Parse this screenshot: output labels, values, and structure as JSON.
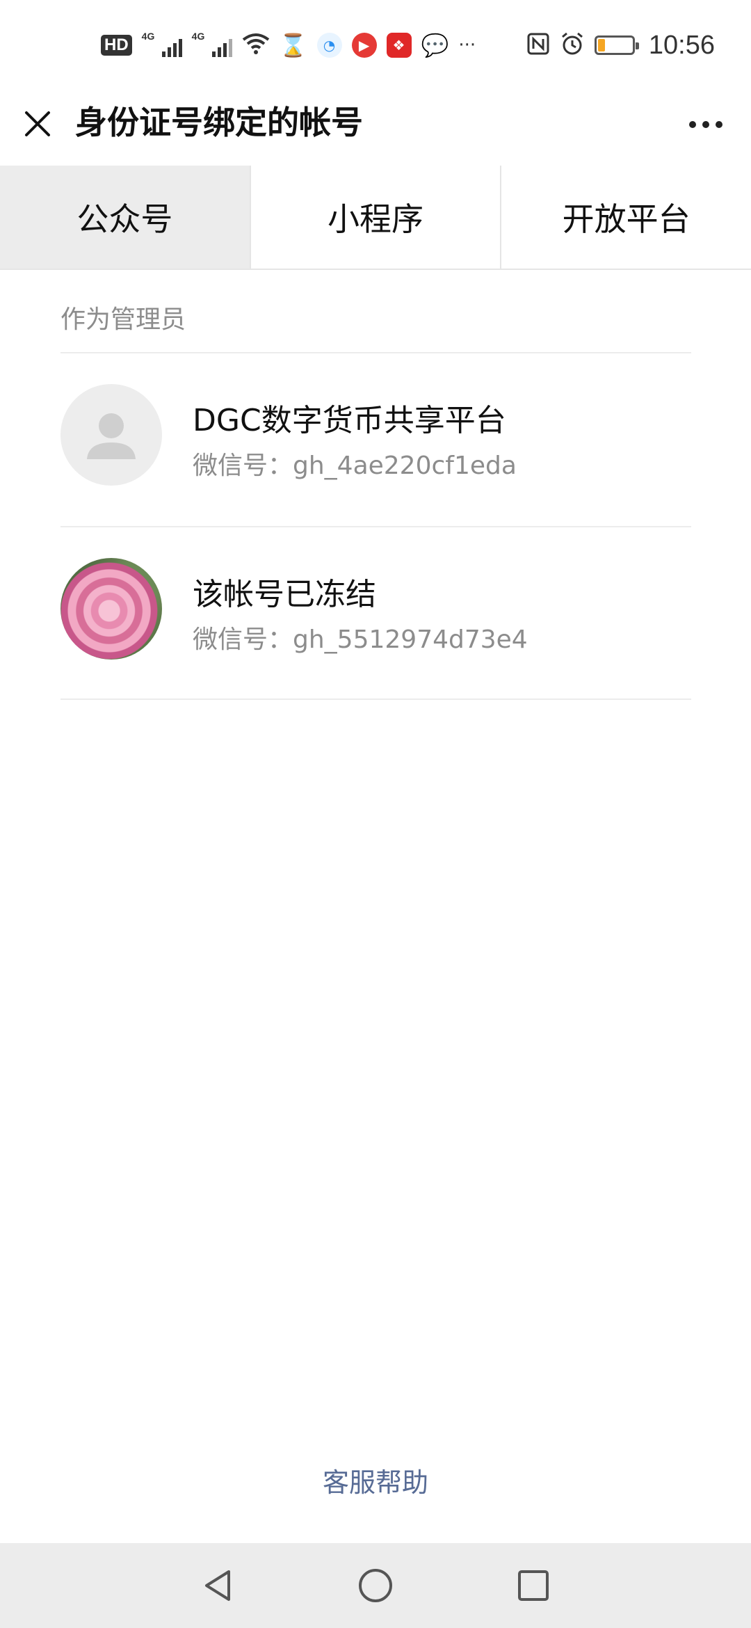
{
  "status_bar": {
    "hd_label": "HD",
    "network_1": "4G",
    "network_2": "4G",
    "more_glyph": "···",
    "time": "10:56",
    "battery_level": 0.2,
    "icons": [
      "hd-icon",
      "signal-icon",
      "wifi-icon",
      "hourglass-icon",
      "app-icon",
      "video-icon",
      "app-icon",
      "chat-icon",
      "nfc-icon",
      "alarm-icon",
      "battery-icon"
    ]
  },
  "header": {
    "title": "身份证号绑定的帐号",
    "close_icon": "close-icon",
    "more_icon": "more-icon"
  },
  "tabs": [
    {
      "label": "公众号",
      "active": true
    },
    {
      "label": "小程序",
      "active": false
    },
    {
      "label": "开放平台",
      "active": false
    }
  ],
  "section": {
    "label": "作为管理员"
  },
  "accounts": [
    {
      "name": "DGC数字货币共享平台",
      "id_line": "微信号：gh_4ae220cf1eda",
      "avatar": "default-avatar"
    },
    {
      "name": "该帐号已冻结",
      "id_line": "微信号：gh_5512974d73e4",
      "avatar": "rose-avatar"
    }
  ],
  "footer": {
    "help_label": "客服帮助"
  },
  "colors": {
    "link": "#576b95",
    "secondary_text": "#8c8c8c",
    "active_tab_bg": "#ececec",
    "battery": "#f5a623"
  }
}
